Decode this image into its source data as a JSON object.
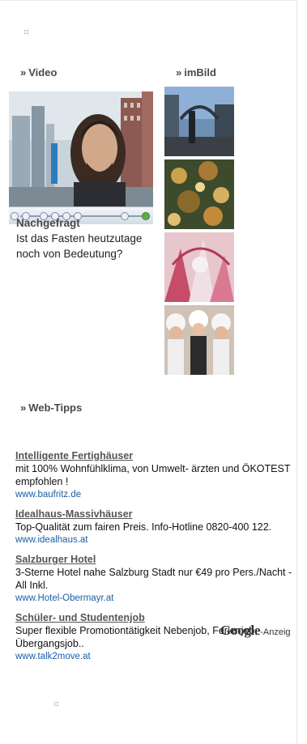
{
  "video_section": {
    "heading": "Video",
    "heading_icon": "raquo",
    "kicker": "Nachgefragt",
    "question": "Ist das Fasten heutzutage noch von Bedeutung?"
  },
  "image_section": {
    "heading": "imBild",
    "heading_icon": "raquo",
    "pictures": [
      "city-street-photo",
      "festival-lights-photo",
      "carnival-costume-photo",
      "group-of-women-photo"
    ]
  },
  "web_tips": {
    "heading": "Web-Tipps",
    "heading_icon": "raquo",
    "ads": [
      {
        "title": "Intelligente Fertighäuser",
        "body": "mit 100% Wohnfühlklima, von Umwelt- ärzten und ÖKOTEST empfohlen !",
        "url": "www.baufritz.de"
      },
      {
        "title": "Idealhaus-Massivhäuser",
        "body": "Top-Qualität zum fairen Preis. Info-Hotline 0820-400 122.",
        "url": "www.idealhaus.at"
      },
      {
        "title": "Salzburger Hotel",
        "body": "3-Sterne Hotel nahe Salzburg Stadt nur €49 pro Pers./Nacht - All Inkl.",
        "url": "www.Hotel-Obermayr.at"
      },
      {
        "title": "Schüler- und Studentenjob",
        "body": "Super flexible Promotiontätigkeit Nebenjob, Ferienjob, Übergangsjob..",
        "url": "www.talk2move.at"
      }
    ],
    "google_word": "Google",
    "google_suffix": "-Anzeig"
  },
  "colors": {
    "heading": "#4a4a4a",
    "ad_url": "#1c5ea6",
    "ad_title": "#555555"
  }
}
